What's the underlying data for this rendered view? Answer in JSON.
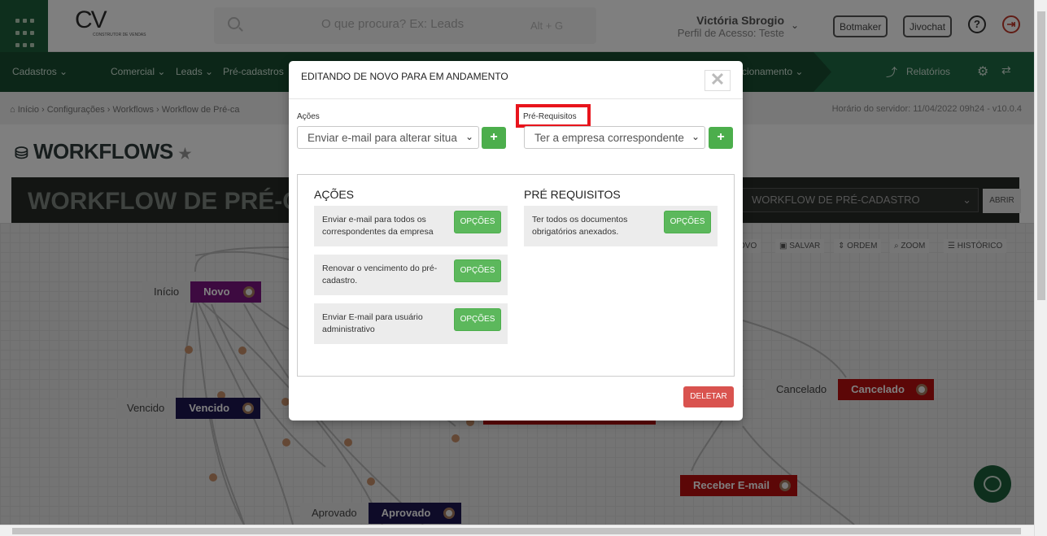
{
  "header": {
    "logo_text": "CV",
    "logo_sub": "CONSTRUTOR DE VENDAS",
    "search_placeholder": "O que procura? Ex: Leads",
    "search_shortcut": "Alt + G",
    "user_name": "Victória Sbrogio",
    "user_profile": "Perfil de Acesso: Teste",
    "botmaker_label": "Botmaker",
    "jivochat_label": "Jivochat",
    "help_symbol": "?",
    "exit_symbol": "⇥"
  },
  "nav": {
    "items": [
      "Cadastros ⌄",
      "Comercial ⌄",
      "Leads ⌄",
      "Pré-cadastros",
      "cionamento ⌄",
      "Relatórios"
    ]
  },
  "breadcrumb": {
    "path": "⌂ Início  ›  Configurações  ›  Workflows  ›  Workflow de Pré-ca",
    "server_time": "Horário do servidor: 11/04/2022 09h24 - v10.0.4"
  },
  "page": {
    "title": "WORKFLOWS",
    "banner_title": "WORKFLOW DE PRÉ-C",
    "workflow_select": "WORKFLOW DE PRÉ-CADASTRO",
    "open_label": "ABRIR",
    "tools": [
      "OVO",
      "SALVAR",
      "ORDEM",
      "ZOOM",
      "HISTÓRICO"
    ]
  },
  "nodes": [
    {
      "label": "Início",
      "state": "Novo",
      "color": "#7b1480"
    },
    {
      "label": "Vencido",
      "state": "Vencido",
      "color": "#1c1650"
    },
    {
      "label": "Cancelado",
      "state": "Cancelado",
      "color": "#b80e0e"
    },
    {
      "label": "Aprovado",
      "state": "Aprovado",
      "color": "#1c1650"
    },
    {
      "label": "",
      "state": "Receber E-mail",
      "color": "#b80e0e"
    }
  ],
  "modal": {
    "title": "EDITANDO DE NOVO PARA EM ANDAMENTO",
    "close_symbol": "✕",
    "acoes_label": "Ações",
    "acoes_select": "Enviar e-mail para alterar situa",
    "prereq_label": "Pré-Requisitos",
    "prereq_select": "Ter a empresa correspondente",
    "add_symbol": "+",
    "acoes_title": "AÇÕES",
    "prereq_title": "PRÉ REQUISITOS",
    "acoes": [
      "Enviar e-mail para todos os correspondentes da empresa",
      "Renovar o vencimento do pré-cadastro.",
      "Enviar E-mail para usuário administrativo"
    ],
    "prereqs": [
      "Ter todos os documentos obrigatórios anexados."
    ],
    "options_label": "OPÇÕES",
    "delete_label": "DELETAR"
  },
  "colors": {
    "brand_green": "#1d5e3a",
    "button_green": "#5cb85c",
    "danger": "#d9534f",
    "highlight": "#e8141c"
  }
}
